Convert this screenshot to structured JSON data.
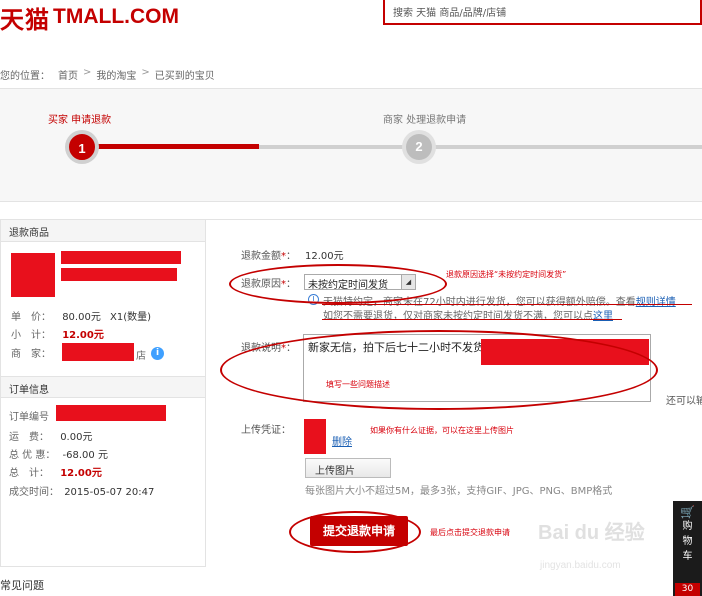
{
  "header": {
    "logo_cn": "天猫",
    "logo_en": "TMALL.COM",
    "search_placeholder": "搜索 天猫 商品/品牌/店铺"
  },
  "breadcrumb": {
    "prefix": "您的位置：",
    "items": [
      "首页",
      "我的淘宝",
      "已买到的宝贝"
    ],
    "separator": ">"
  },
  "steps": [
    {
      "label": "买家 申请退款",
      "number": "1",
      "active": true
    },
    {
      "label": "商家 处理退款申请",
      "number": "2",
      "active": false
    }
  ],
  "product_panel": {
    "title": "退款商品",
    "unit_price_label": "单　价：",
    "unit_price": "80.00元",
    "quantity": "X1(数量)",
    "subtotal_label": "小　计：",
    "subtotal": "12.00元",
    "seller_label": "商　家：",
    "store_suffix": "店"
  },
  "order_panel": {
    "title": "订单信息",
    "order_no_label": "订单编号",
    "shipping_label": "运　费：",
    "shipping": "0.00元",
    "discount_label": "总 优 惠：",
    "discount": "-68.00 元",
    "total_label": "总　计：",
    "total": "12.00元",
    "time_label": "成交时间：",
    "time": "2015-05-07 20:47"
  },
  "form": {
    "amount_label": "退款金额",
    "amount": "12.00元",
    "reason_label": "退款原因",
    "reason_value": "未按约定时间发货",
    "tip_line1": "天猫特约定，商家未在72小时内进行发货，您可以获得额外赔偿。查看",
    "tip_link1": "规则详情",
    "tip_line2": "如您不需要退货，仅对商家未按约定时间发货不满，您可以点",
    "tip_link2": "这里",
    "desc_label": "退款说明",
    "desc_value": "新家无信，拍下后七十二小时不发货",
    "remaining_cut": "还可以输",
    "upload_label": "上传凭证",
    "delete_link": "删除",
    "upload_button": "上传图片",
    "upload_hint": "每张图片大小不超过5M，最多3张，支持GIF、JPG、PNG、BMP格式",
    "submit_button": "提交退款申请"
  },
  "annotations": {
    "reason": "退款原因选择“未按约定时间发货”",
    "desc": "填写一些问题描述",
    "upload": "如果你有什么证据，可以在这里上传图片",
    "submit": "最后点击提交退款申请"
  },
  "sidebar_cart": {
    "label_chars": [
      "购",
      "物",
      "车"
    ],
    "count": "30"
  },
  "faq_title": "常见问题",
  "watermark": {
    "main": "Bai du 经验",
    "sub": "jingyan.baidu.com"
  },
  "colors": {
    "brand": "#c40000",
    "link": "#1a5fb4",
    "redact": "#e8101c"
  }
}
